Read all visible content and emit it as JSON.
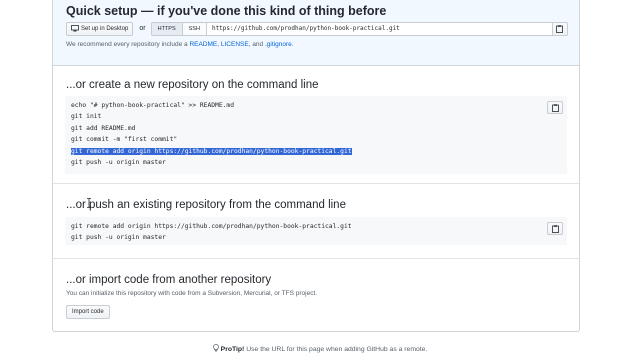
{
  "quick_setup": {
    "title": "Quick setup — if you've done this kind of thing before",
    "desktop_button": "Set up in Desktop",
    "or": "or",
    "https_label": "HTTPS",
    "ssh_label": "SSH",
    "clone_url": "https://github.com/prodhan/python-book-practical.git",
    "recommend_prefix": "We recommend every repository include a ",
    "readme_link": "README",
    "sep1": ", ",
    "license_link": "LICENSE",
    "sep2": ", and ",
    "gitignore_link": ".gitignore",
    "recommend_suffix": "."
  },
  "new_repo": {
    "title": "...or create a new repository on the command line",
    "lines": [
      "echo \"# python-book-practical\" >> README.md",
      "git init",
      "git add README.md",
      "git commit -m \"first commit\"",
      "git remote add origin https://github.com/prodhan/python-book-practical.git",
      "git push -u origin master"
    ]
  },
  "push_repo": {
    "title": "...or push an existing repository from the command line",
    "lines": [
      "git remote add origin https://github.com/prodhan/python-book-practical.git",
      "git push -u origin master"
    ]
  },
  "import_repo": {
    "title": "...or import code from another repository",
    "description": "You can initialize this repository with code from a Subversion, Mercurial, or TFS project.",
    "button": "Import code"
  },
  "protip": {
    "label": "ProTip!",
    "text": " Use the URL for this page when adding GitHub as a remote."
  },
  "colors": {
    "link": "#0366d6",
    "selection": "#3367d6",
    "quick_setup_bg": "#f1f8ff"
  }
}
